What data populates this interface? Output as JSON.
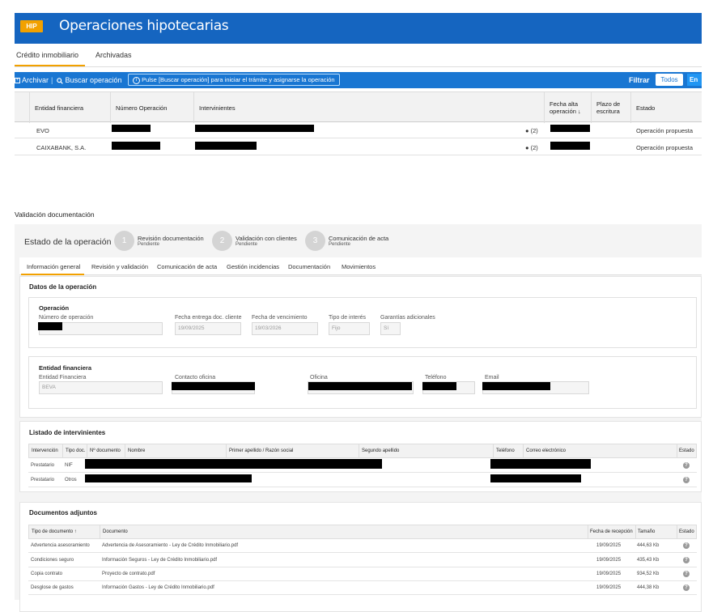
{
  "app": {
    "badge": "HIP",
    "title": "Operaciones hipotecarias"
  },
  "main_tabs": [
    {
      "label": "Crédito inmobiliario",
      "active": true
    },
    {
      "label": "Archivadas",
      "active": false
    }
  ],
  "toolbar": {
    "archive_label": "Archivar",
    "separator": "|",
    "search_label": "Buscar operación",
    "hint": "Pulse [Buscar operación] para iniciar el trámite y asignarse la operación",
    "filter_label": "Filtrar",
    "all_label": "Todos",
    "en_label": "En",
    "accent": "#1976d2",
    "badge_color": "#f2a100"
  },
  "ops_table": {
    "headers": [
      "Entidad financiera",
      "Número Operación",
      "Intervinientes",
      "Fecha alta operación ↓",
      "Plazo de escritura",
      "Estado"
    ],
    "rows": [
      {
        "entidad": "EVO",
        "count": "(2)",
        "estado": "Operación propuesta"
      },
      {
        "entidad": "CAIXABANK, S.A.",
        "count": "(2)",
        "estado": "Operación propuesta"
      }
    ]
  },
  "validacion": {
    "section_title": "Validación documentación",
    "estado_title": "Estado de la operación",
    "steps": [
      {
        "num": "1",
        "title": "Revisión documentación",
        "status": "Pendiente"
      },
      {
        "num": "2",
        "title": "Validación con clientes",
        "status": "Pendiente"
      },
      {
        "num": "3",
        "title": "Comunicación de acta",
        "status": "Pendiente"
      }
    ],
    "tabs": [
      "Información general",
      "Revisión y validación",
      "Comunicación de acta",
      "Gestión incidencias",
      "Documentación",
      "Movimientos"
    ]
  },
  "datos": {
    "title": "Datos de la operación",
    "operacion": {
      "title": "Operación",
      "numero_label": "Número de operación",
      "fecha_entrega_label": "Fecha entrega doc. cliente",
      "fecha_entrega": "19/09/2025",
      "fecha_venc_label": "Fecha de vencimiento",
      "fecha_venc": "19/03/2026",
      "tipo_interes_label": "Tipo de interés",
      "tipo_interes": "Fijo",
      "garantias_label": "Garantías adicionales",
      "garantias": "Sí"
    },
    "entidad": {
      "title": "Entidad financiera",
      "entidad_label": "Entidad Financiera",
      "entidad_value": "BEVA",
      "contacto_label": "Contacto oficina",
      "oficina_label": "Oficina",
      "telefono_label": "Teléfono",
      "email_label": "Email"
    }
  },
  "intervinientes": {
    "title": "Listado de intervinientes",
    "headers": [
      "Intervención",
      "Tipo doc.",
      "Nº documento",
      "Nombre",
      "Primer apellido / Razón social",
      "Segundo apellido",
      "Teléfono",
      "Correo electrónico",
      "Estado"
    ],
    "rows": [
      {
        "intervencion": "Prestatario",
        "tipo": "NIF"
      },
      {
        "intervencion": "Prestatario",
        "tipo": "Otros"
      }
    ]
  },
  "documentos": {
    "title": "Documentos adjuntos",
    "headers": [
      "Tipo de documento ↑",
      "Documento",
      "Fecha de recepción",
      "Tamaño",
      "Estado"
    ],
    "rows": [
      {
        "tipo": "Advertencia asesoramiento",
        "documento": "Advertencia de Asesoramiento - Ley de Crédito Inmobiliario.pdf",
        "fecha": "19/09/2025",
        "size": "444,63 Kb"
      },
      {
        "tipo": "Condiciones seguro",
        "documento": "Información Seguros - Ley de Crédito Inmobiliario.pdf",
        "fecha": "19/09/2025",
        "size": "435,43 Kb"
      },
      {
        "tipo": "Copia contrato",
        "documento": "Proyecto de contrato.pdf",
        "fecha": "19/09/2025",
        "size": "934,52 Kb"
      },
      {
        "tipo": "Desglose de gastos",
        "documento": "Información Gastos - Ley de Crédito Inmobiliario.pdf",
        "fecha": "19/09/2025",
        "size": "444,38 Kb"
      }
    ]
  }
}
